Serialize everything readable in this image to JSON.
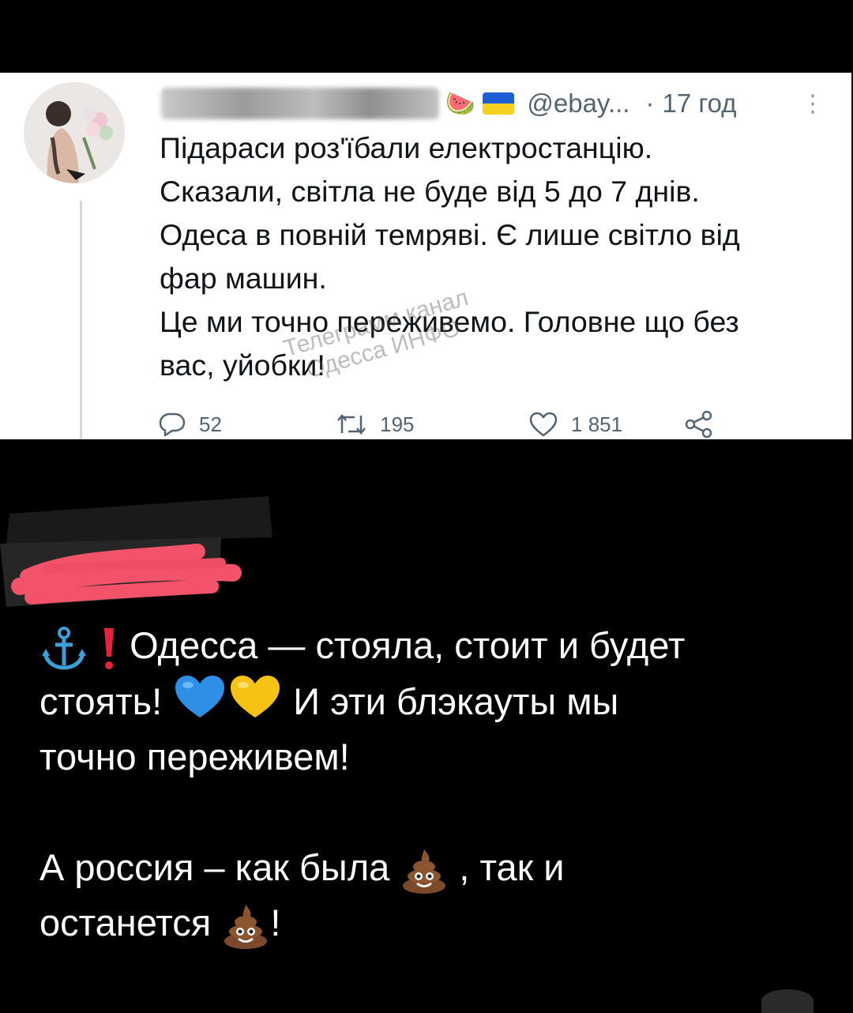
{
  "tweet": {
    "handle": "@ebay...",
    "time": "17 год",
    "lines": [
      "Підараси роз'їбали електростанцію.",
      "Сказали, світла не буде від 5 до 7 днів.",
      "Одеса в повній темряві. Є лише світло від",
      "фар машин.",
      "Це ми точно переживемо. Головне що без",
      "вас, уйобки!"
    ],
    "watermark": [
      "Телеграмм канал",
      "Одесса ИНФО"
    ],
    "replies": "52",
    "retweets": "195",
    "likes": "1 851"
  },
  "post": {
    "line1": "Одесса  — стояла, стоит и будет",
    "line2_a": "стоять!",
    "line2_b": "И эти блэкауты мы",
    "line3": "точно переживем!",
    "line4_a": "А россия – как была",
    "line4_b": ", так и",
    "line5_a": "останется",
    "line5_b": "!"
  },
  "colors": {
    "background": "#000000",
    "tweet_bg": "#ffffff",
    "tweet_text": "#0f1419",
    "tweet_meta": "#536471",
    "redaction": "#f2526a"
  }
}
